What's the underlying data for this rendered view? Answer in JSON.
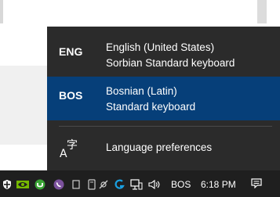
{
  "flyout": {
    "items": [
      {
        "code": "ENG",
        "language": "English (United States)",
        "keyboard": "Sorbian Standard keyboard",
        "selected": false
      },
      {
        "code": "BOS",
        "language": "Bosnian (Latin)",
        "keyboard": "Standard keyboard",
        "selected": true
      }
    ],
    "preferences_label": "Language preferences",
    "preferences_icon": "language-icon",
    "highlight_color": "#063f79",
    "background_color": "#2b2b2b"
  },
  "taskbar": {
    "tray_icons": [
      "shield-icon",
      "nvidia-icon",
      "torrent-icon",
      "viber-icon",
      "usb-icon",
      "tablet-icon",
      "satellite-icon",
      "logitech-icon",
      "network-icon",
      "volume-icon"
    ],
    "input_indicator": "BOS",
    "clock": "6:18 PM",
    "notification_icon": "action-center-icon"
  }
}
